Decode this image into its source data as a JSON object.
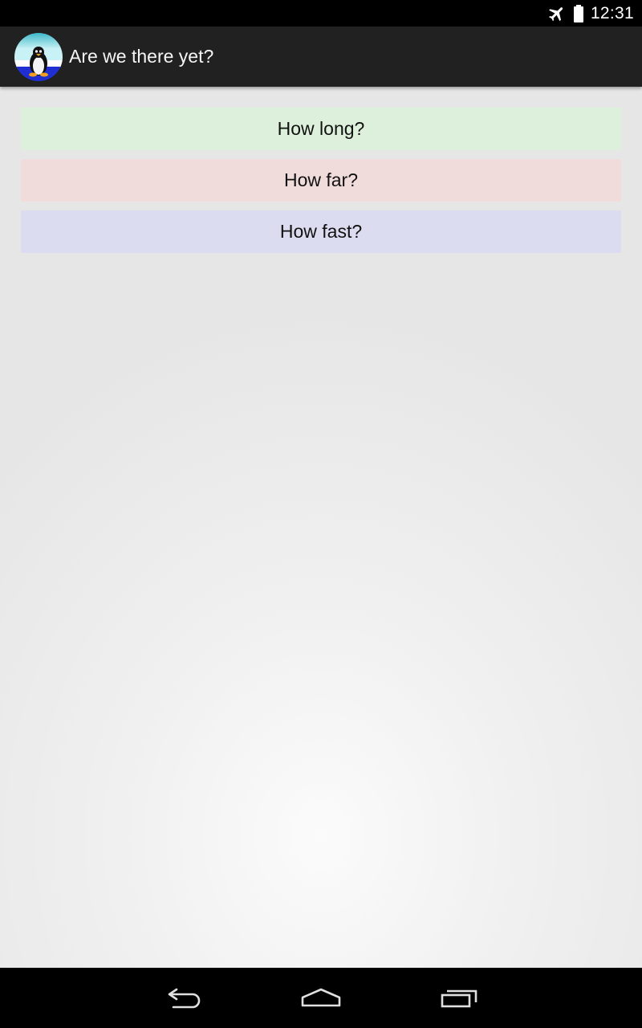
{
  "status_bar": {
    "time": "12:31",
    "icons": [
      "airplane-mode-icon",
      "battery-icon"
    ]
  },
  "action_bar": {
    "title": "Are we there yet?",
    "app_icon": "penguin-app-icon"
  },
  "buttons": {
    "how_long": "How long?",
    "how_far": "How far?",
    "how_fast": "How fast?"
  },
  "nav_bar": {
    "icons": [
      "back-icon",
      "home-icon",
      "recents-icon"
    ]
  },
  "colors": {
    "how_long_bg": "#dcf0dc",
    "how_far_bg": "#f1dcdc",
    "how_fast_bg": "#dcdcf0",
    "action_bar_bg": "#212121"
  }
}
